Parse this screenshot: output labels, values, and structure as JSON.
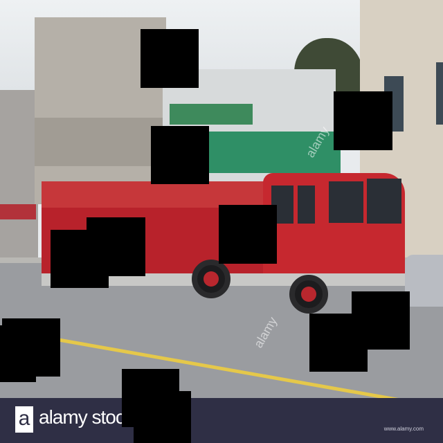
{
  "watermark": {
    "brand_letter": "a",
    "brand_text": "alamy stoc",
    "site": "www.alamy.com",
    "overlay_text": "alamy"
  },
  "colors": {
    "bar": "#2f2f45",
    "truck_red": "#b8222b",
    "road_line": "#e5c84a"
  }
}
